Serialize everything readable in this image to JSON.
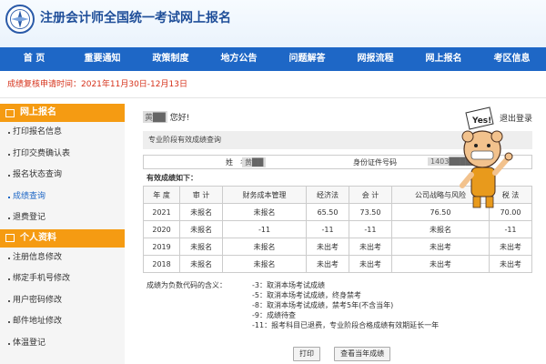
{
  "header": {
    "title": "注册会计师全国统一考试网上报名"
  },
  "nav": [
    "首 页",
    "重要通知",
    "政策制度",
    "地方公告",
    "问题解答",
    "网报流程",
    "网上报名",
    "考区信息"
  ],
  "notice": "成绩复核申请时间：2021年11月30日-12月13日",
  "sidebar": {
    "section1": "网上报名",
    "items1": [
      "打印报名信息",
      "打印交费确认表",
      "报名状态查询",
      "成绩查询",
      "退费登记"
    ],
    "section2": "个人资料",
    "items2": [
      "注册信息修改",
      "绑定手机号修改",
      "用户密码修改",
      "邮件地址修改",
      "体温登记"
    ]
  },
  "main": {
    "greeting_name": "黄██",
    "greeting_suffix": "您好!",
    "logout": "退出登录",
    "panel_title": "专业阶段有效成绩查询",
    "name_label": "姓　名",
    "name_value": "黄██",
    "id_label": "身份证件号码",
    "id_value": "1403██████",
    "valid_label": "有效成绩如下：",
    "table": {
      "headers": [
        "年 度",
        "审 计",
        "财务成本管理",
        "经济法",
        "会 计",
        "公司战略与风险",
        "税 法"
      ],
      "rows": [
        [
          "2021",
          "未报名",
          "未报名",
          "65.50",
          "73.50",
          "76.50",
          "70.00"
        ],
        [
          "2020",
          "未报名",
          "-11",
          "-11",
          "-11",
          "未报名",
          "-11"
        ],
        [
          "2019",
          "未报名",
          "未报名",
          "未出考",
          "未出考",
          "未出考",
          "未出考"
        ],
        [
          "2018",
          "未报名",
          "未报名",
          "未出考",
          "未出考",
          "未出考",
          "未出考"
        ]
      ]
    },
    "legend_title": "成绩为负数代码的含义：",
    "legend_items": [
      "-3：取消本场考试成绩",
      "-5：取消本场考试成绩，终身禁考",
      "-8：取消本场考试成绩，禁考5年(不含当年)",
      "-9：成绩待查",
      "-11：报考科目已退费，专业阶段合格成绩有效期延长一年"
    ],
    "print_button": "打印",
    "view_year_button": "查看当年成绩",
    "mascot_text": "Yes!"
  }
}
